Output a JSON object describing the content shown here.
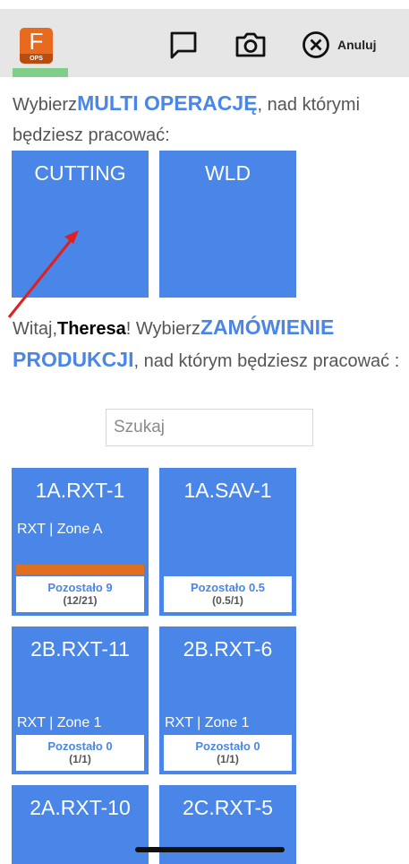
{
  "app": {
    "logo_letter": "F",
    "logo_sub": "OPS"
  },
  "toolbar": {
    "chat_icon": "chat-icon",
    "camera_icon": "camera-icon",
    "cancel_label": "Anuluj"
  },
  "operations_prompt": {
    "prefix": "Wybierz",
    "highlight": "MULTI OPERACJĘ",
    "suffix": ", nad którymi będziesz pracować:"
  },
  "operations": [
    {
      "label": "CUTTING"
    },
    {
      "label": "WLD"
    }
  ],
  "orders_prompt": {
    "greeting": "Witaj,",
    "user": "Theresa",
    "prefix": "! Wybierz",
    "highlight": "ZAMÓWIENIE PRODUKCJI",
    "suffix": ", nad którym będziesz pracować :"
  },
  "search": {
    "placeholder": "Szukaj",
    "value": ""
  },
  "orders": [
    {
      "title": "1A.RXT-1",
      "subtitle": "RXT | Zone A",
      "remaining": "Pozostało 9",
      "count": "(12/21)",
      "progress": 1.0
    },
    {
      "title": "1A.SAV-1",
      "subtitle": "",
      "remaining": "Pozostało 0.5",
      "count": "(0.5/1)",
      "progress": 0
    },
    {
      "title": "2B.RXT-11",
      "subtitle": "RXT | Zone 1",
      "remaining": "Pozostało 0",
      "count": "(1/1)",
      "progress": 0
    },
    {
      "title": "2B.RXT-6",
      "subtitle": "RXT | Zone 1",
      "remaining": "Pozostało 0",
      "count": "(1/1)",
      "progress": 0
    },
    {
      "title": "2A.RXT-10",
      "subtitle": "",
      "remaining": "",
      "count": "",
      "progress": 0
    },
    {
      "title": "2C.RXT-5",
      "subtitle": "",
      "remaining": "",
      "count": "",
      "progress": 0
    }
  ],
  "colors": {
    "accent": "#4a86e8",
    "progress": "#e07020",
    "logo": "#e86a1f",
    "annotation_arrow": "#e02020"
  }
}
